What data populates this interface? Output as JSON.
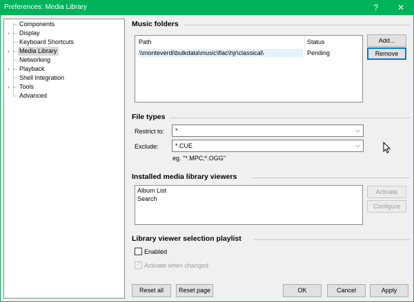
{
  "window": {
    "title": "Preferences: Media Library",
    "help_glyph": "?",
    "close_glyph": "✕"
  },
  "tree": {
    "items": [
      {
        "label": "Components",
        "expandable": false
      },
      {
        "label": "Display",
        "expandable": true
      },
      {
        "label": "Keyboard Shortcuts",
        "expandable": false
      },
      {
        "label": "Media Library",
        "expandable": true,
        "selected": true
      },
      {
        "label": "Networking",
        "expandable": false
      },
      {
        "label": "Playback",
        "expandable": true
      },
      {
        "label": "Shell Integration",
        "expandable": false
      },
      {
        "label": "Tools",
        "expandable": true
      },
      {
        "label": "Advanced",
        "expandable": false
      }
    ]
  },
  "music_folders": {
    "title": "Music folders",
    "columns": {
      "path": "Path",
      "status": "Status"
    },
    "rows": [
      {
        "path": "\\\\monteverdi\\bulkdata\\music\\flac\\hjr\\classical\\",
        "status": "Pending"
      }
    ],
    "add_label": "Add...",
    "remove_label": "Remove"
  },
  "file_types": {
    "title": "File types",
    "restrict_label": "Restrict to:",
    "restrict_value": "*",
    "exclude_label": "Exclude:",
    "exclude_value": "*.CUE",
    "hint": "eg. \"*.MPC;*.OGG\""
  },
  "viewers": {
    "title": "Installed media library viewers",
    "items": [
      "Album List",
      "Search"
    ],
    "activate_label": "Activate",
    "configure_label": "Configure"
  },
  "playlist": {
    "title": "Library viewer selection playlist",
    "enabled_label": "Enabled",
    "enabled_checked": false,
    "activate_when_changed_label": "Activate when changed",
    "activate_when_changed_checked": true
  },
  "footer": {
    "reset_all_label": "Reset all",
    "reset_page_label": "Reset page",
    "ok_label": "OK",
    "cancel_label": "Cancel",
    "apply_label": "Apply"
  },
  "colors": {
    "titlebar": "#00b25a",
    "focus": "#0078d7"
  },
  "icons": {
    "expand": "chevron-right-icon",
    "dropdown": "chevron-down-icon"
  }
}
